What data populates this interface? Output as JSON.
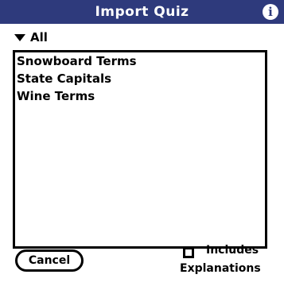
{
  "window": {
    "title": "Import Quiz",
    "info_glyph": "i"
  },
  "category": {
    "selected": "All"
  },
  "quiz_list": {
    "items": [
      {
        "label": "Snowboard Terms"
      },
      {
        "label": "State Capitals"
      },
      {
        "label": "Wine Terms"
      }
    ]
  },
  "buttons": {
    "cancel_label": "Cancel"
  },
  "options": {
    "includes_label_line1": "Includes",
    "includes_label_line2": "Explanations",
    "includes_checked": false
  },
  "colors": {
    "titlebar": "#2e3a7c",
    "text": "#000000",
    "background": "#ffffff"
  }
}
